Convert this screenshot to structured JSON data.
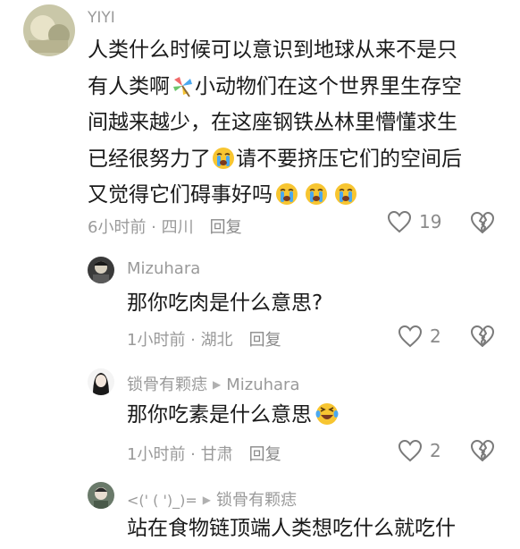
{
  "comments": [
    {
      "username": "YIYI",
      "lines": [
        "人类什么时候可以意识到地球从来不是只",
        "有人类啊",
        "小动物们在这个世界里生存空",
        "间越来越少，在这座钢铁丛林里懵懂求生",
        "已经很努力了",
        "请不要挤压它们的空间后",
        "又觉得它们碍事好吗"
      ],
      "time": "6小时前",
      "location": "四川",
      "reply_label": "回复",
      "likes": "19"
    },
    {
      "username": "Mizuhara",
      "text": "那你吃肉是什么意思?",
      "time": "1小时前",
      "location": "湖北",
      "reply_label": "回复",
      "likes": "2"
    },
    {
      "username": "锁骨有颗痣",
      "reply_to": "Mizuhara",
      "text": "那你吃素是什么意思",
      "time": "1小时前",
      "location": "甘肃",
      "reply_label": "回复",
      "likes": "2"
    },
    {
      "username": "<(' ( ')_)=",
      "reply_to": "锁骨有颗痣",
      "text": "站在食物链顶端人类想吃什么就吃什"
    }
  ],
  "colors": {
    "text": "#1a1a1a",
    "meta": "#9a9a9a",
    "emoji_face": "#f7c531",
    "emoji_tear": "#4aa8f0"
  },
  "icons": [
    "heart-outline-icon",
    "broken-heart-icon",
    "crying-face-emoji",
    "pinwheel-emoji"
  ]
}
